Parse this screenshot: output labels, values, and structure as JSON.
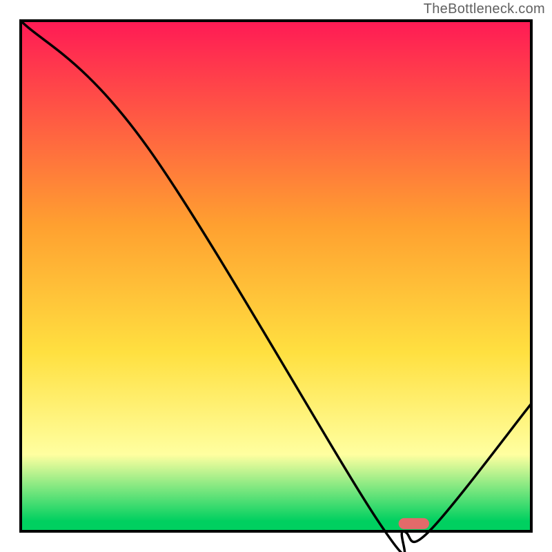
{
  "watermark": {
    "text": "TheBottleneck.com"
  },
  "colors": {
    "gradient_top": "#ff1a55",
    "gradient_mid_orange": "#ffa030",
    "gradient_yellow": "#ffe040",
    "gradient_pale_yellow": "#ffffa0",
    "gradient_green": "#00d060",
    "curve_stroke": "#000000",
    "marker_fill": "#e26a6a",
    "plot_border": "#000000"
  },
  "chart_data": {
    "type": "line",
    "title": "",
    "xlabel": "",
    "ylabel": "",
    "xlim": [
      0,
      100
    ],
    "ylim": [
      0,
      100
    ],
    "series": [
      {
        "name": "bottleneck-curve",
        "x": [
          0,
          25,
          70,
          75,
          80,
          100
        ],
        "y": [
          100,
          75,
          2,
          0,
          0,
          25
        ]
      }
    ],
    "marker": {
      "name": "optimal-range",
      "x_start": 74,
      "x_end": 80,
      "y": 1.5
    },
    "gradient_stops_pct": [
      {
        "offset": 0,
        "color": "#ff1a55"
      },
      {
        "offset": 40,
        "color": "#ffa030"
      },
      {
        "offset": 65,
        "color": "#ffe040"
      },
      {
        "offset": 85,
        "color": "#ffffa0"
      },
      {
        "offset": 98,
        "color": "#00d060"
      }
    ]
  }
}
